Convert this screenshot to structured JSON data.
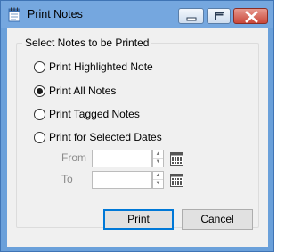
{
  "window": {
    "title": "Print Notes",
    "title_icon": "notepad-icon",
    "controls": [
      "minimize-icon",
      "maximize-icon",
      "close-icon"
    ]
  },
  "group": {
    "title": "Select Notes to be Printed"
  },
  "options": [
    {
      "label": "Print Highlighted Note",
      "selected": false
    },
    {
      "label": "Print All Notes",
      "selected": true
    },
    {
      "label": "Print Tagged Notes",
      "selected": false
    },
    {
      "label": "Print for Selected Dates",
      "selected": false
    }
  ],
  "dates": {
    "from_label": "From",
    "from_value": "",
    "to_label": "To",
    "to_value": "",
    "calendar_icon": "calendar-icon"
  },
  "buttons": {
    "print_label": "Print",
    "cancel_label": "Cancel"
  },
  "colors": {
    "titlebar": "#75a7df",
    "close_button": "#c9473a",
    "dialog_background": "#f0f0f0",
    "default_button_border": "#0078d7"
  }
}
